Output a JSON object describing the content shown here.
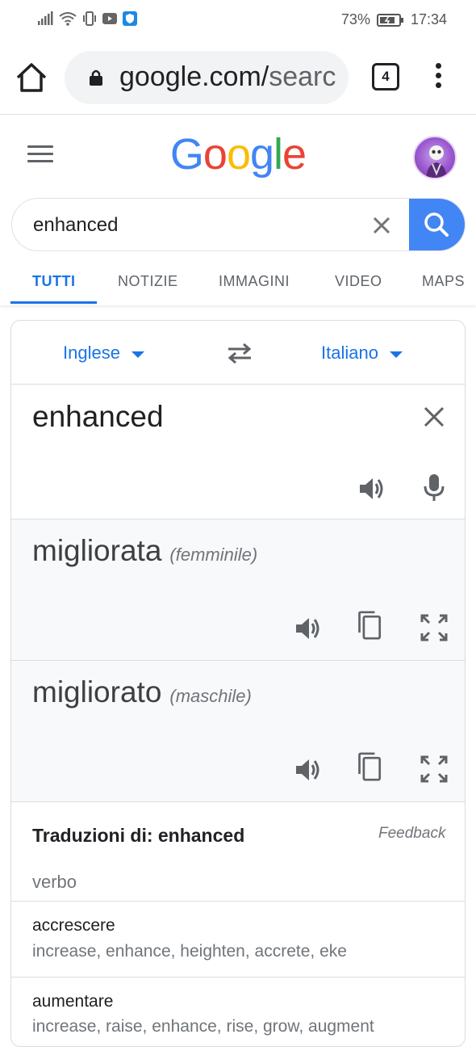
{
  "status_bar": {
    "battery": "73%",
    "time": "17:34"
  },
  "browser": {
    "url_main": "google.com/",
    "url_rest": "searc",
    "tab_count": "4"
  },
  "google": {
    "logo_letters": [
      {
        "char": "G",
        "color": "#4285f4"
      },
      {
        "char": "o",
        "color": "#ea4335"
      },
      {
        "char": "o",
        "color": "#fbbc05"
      },
      {
        "char": "g",
        "color": "#4285f4"
      },
      {
        "char": "l",
        "color": "#34a853"
      },
      {
        "char": "e",
        "color": "#ea4335"
      }
    ]
  },
  "search": {
    "query": "enhanced"
  },
  "tabs": [
    "TUTTI",
    "NOTIZIE",
    "IMMAGINI",
    "VIDEO",
    "MAPS"
  ],
  "translate": {
    "source_lang": "Inglese",
    "target_lang": "Italiano",
    "source_text": "enhanced",
    "results": [
      {
        "word": "migliorata",
        "gender": "(femminile)"
      },
      {
        "word": "migliorato",
        "gender": "(maschile)"
      }
    ],
    "translations_title": "Traduzioni di: enhanced",
    "feedback": "Feedback",
    "part_of_speech": "verbo",
    "entries": [
      {
        "word": "accrescere",
        "synonyms": "increase, enhance, heighten, accrete, eke"
      },
      {
        "word": "aumentare",
        "synonyms": "increase, raise, enhance, rise, grow, augment"
      }
    ]
  },
  "colors": {
    "accent_blue": "#1a73e8",
    "search_button": "#4285f4"
  }
}
